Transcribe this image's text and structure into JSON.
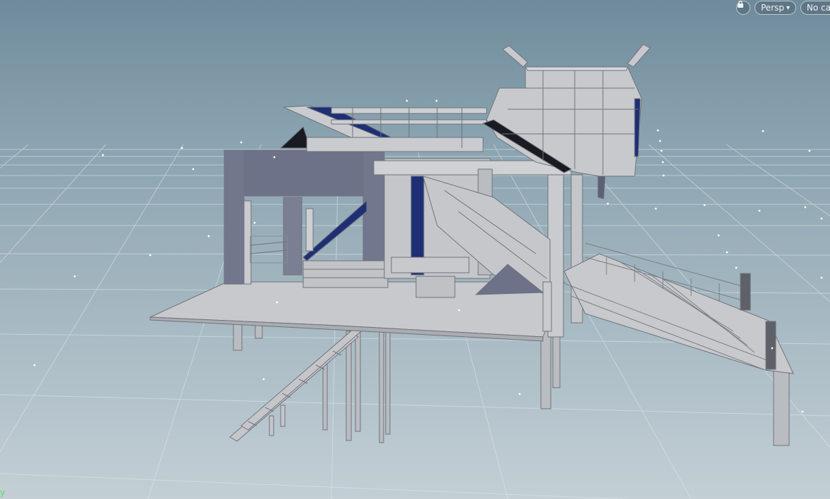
{
  "viewport": {
    "bg_top": "#6f8b9b",
    "bg_bottom": "#c4d0d6",
    "grid_color": "#e1e8ec",
    "model_fill": "#c9cbcf",
    "model_stroke": "#7b7f86",
    "accent_blue": "#1e2f75",
    "panel_slate": "#6d7289"
  },
  "toolbar": {
    "lock_icon": "lock-icon",
    "view_label": "Persp",
    "view_arrow": "▾",
    "camera_label": "No cam"
  },
  "axis": {
    "label": "y"
  }
}
